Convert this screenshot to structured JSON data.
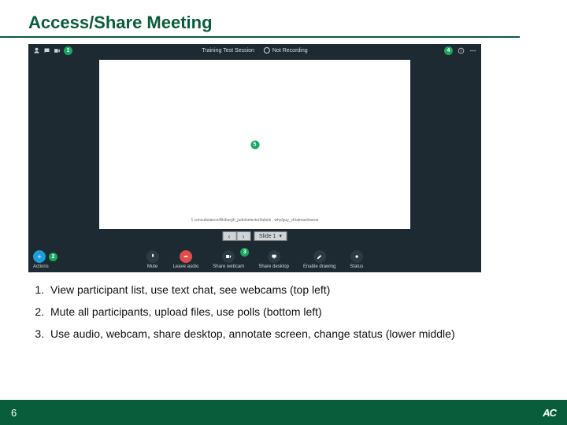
{
  "title": "Access/Share Meeting",
  "screenshot": {
    "session_title": "Training Test Session",
    "recording_label": "Not Recording",
    "badges": {
      "top_left": "1",
      "top_right": "4",
      "canvas_center": "5",
      "bottom_left": "2",
      "share_webcam": "3"
    },
    "canvas_footer_text": "1 concubulance/Alsburgh_judo/selector/labels . why/guy_ch/almaslineear",
    "pager": {
      "slide_label": "Slide 1",
      "dropdown": "▾"
    },
    "controls": {
      "actions": "Actions",
      "mute": "Mute",
      "leave_audio": "Leave audio",
      "share_webcam": "Share webcam",
      "share_desktop": "Share desktop",
      "enable_drawing": "Enable drawing",
      "status": "Status"
    }
  },
  "steps": [
    "View participant list, use text chat, see webcams (top left)",
    "Mute all participants, upload files, use polls (bottom left)",
    "Use audio, webcam, share desktop, annotate screen, change status (lower middle)"
  ],
  "page_number": "6",
  "logo": "AC"
}
